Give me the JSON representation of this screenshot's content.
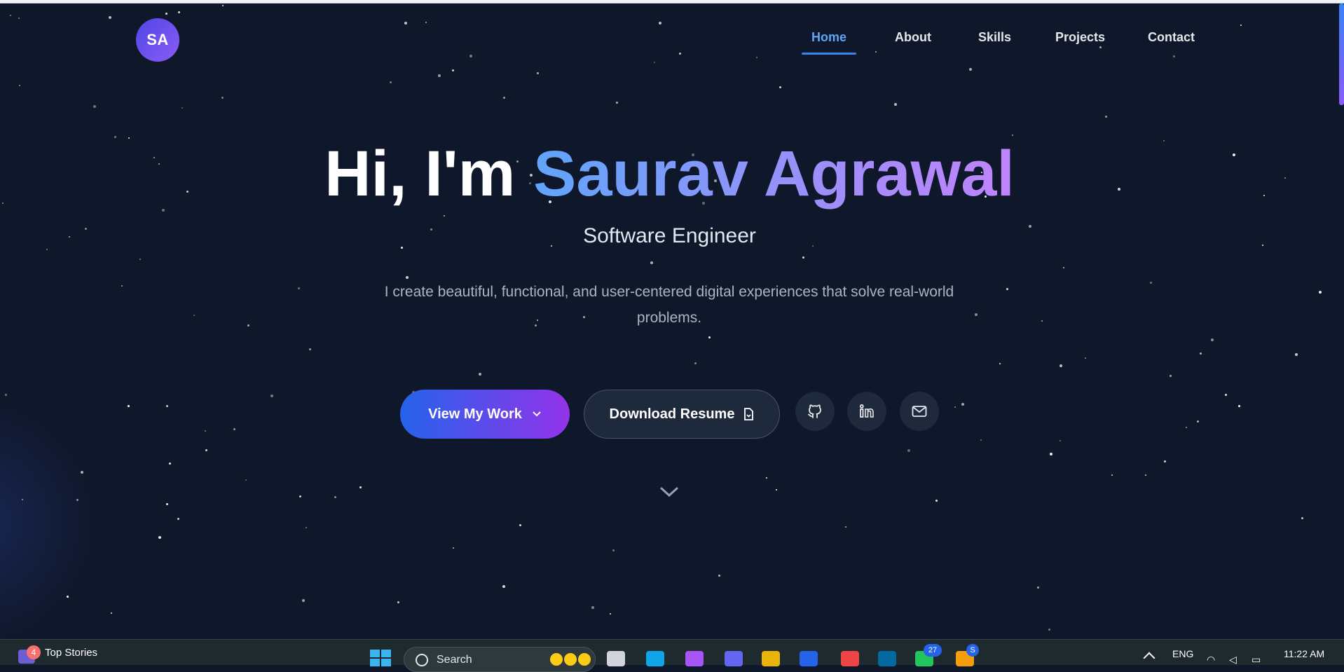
{
  "brand": {
    "logo_text": "SA"
  },
  "nav": {
    "items": [
      {
        "label": "Home",
        "active": true
      },
      {
        "label": "About",
        "active": false
      },
      {
        "label": "Skills",
        "active": false
      },
      {
        "label": "Projects",
        "active": false
      },
      {
        "label": "Contact",
        "active": false
      }
    ]
  },
  "hero": {
    "greeting": "Hi, I'm",
    "name": "Saurav Agrawal",
    "subtitle": "Software Engineer",
    "description": "I create beautiful, functional, and user-centered digital experiences that solve real-world problems.",
    "primary_button": "View My Work",
    "secondary_button": "Download Resume",
    "social": [
      "github-icon",
      "linkedin-icon",
      "mail-icon"
    ]
  },
  "colors": {
    "background": "#0f172a",
    "accent_blue": "#60a5fa",
    "accent_purple": "#a78bfa",
    "button_gradient_start": "#2563eb",
    "button_gradient_end": "#9333ea"
  },
  "taskbar": {
    "news_badge": "4",
    "news_title": "Top Stories",
    "search_placeholder": "Search",
    "whatsapp_badge": "27",
    "chrome_badge": "S",
    "language": "ENG",
    "time": "11:22 AM"
  }
}
